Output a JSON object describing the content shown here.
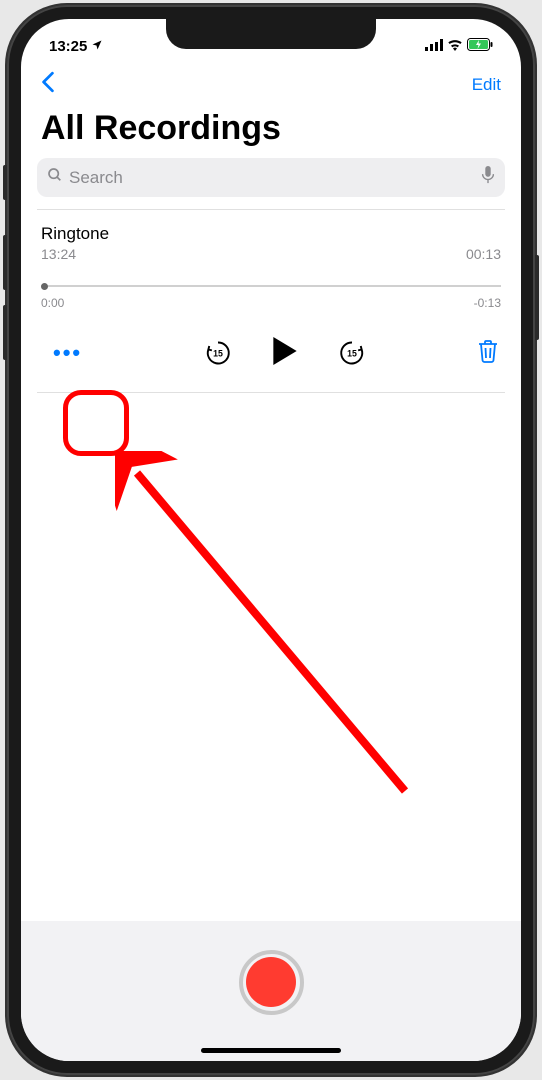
{
  "status": {
    "time": "13:25",
    "location_icon": "location-arrow-icon",
    "signal": "signal-icon",
    "wifi": "wifi-icon",
    "battery": "battery-charging-icon"
  },
  "nav": {
    "back_icon": "chevron-left-icon",
    "edit_label": "Edit"
  },
  "title": "All Recordings",
  "search": {
    "placeholder": "Search",
    "search_icon": "magnifier-icon",
    "mic_icon": "microphone-icon"
  },
  "recording": {
    "title": "Ringtone",
    "time": "13:24",
    "duration": "00:13",
    "scrubber_start": "0:00",
    "scrubber_end": "-0:13"
  },
  "controls": {
    "more_label": "•••",
    "skip_back_value": "15",
    "skip_fwd_value": "15",
    "play_icon": "play-icon",
    "trash_icon": "trash-icon"
  },
  "record_icon": "record-icon"
}
